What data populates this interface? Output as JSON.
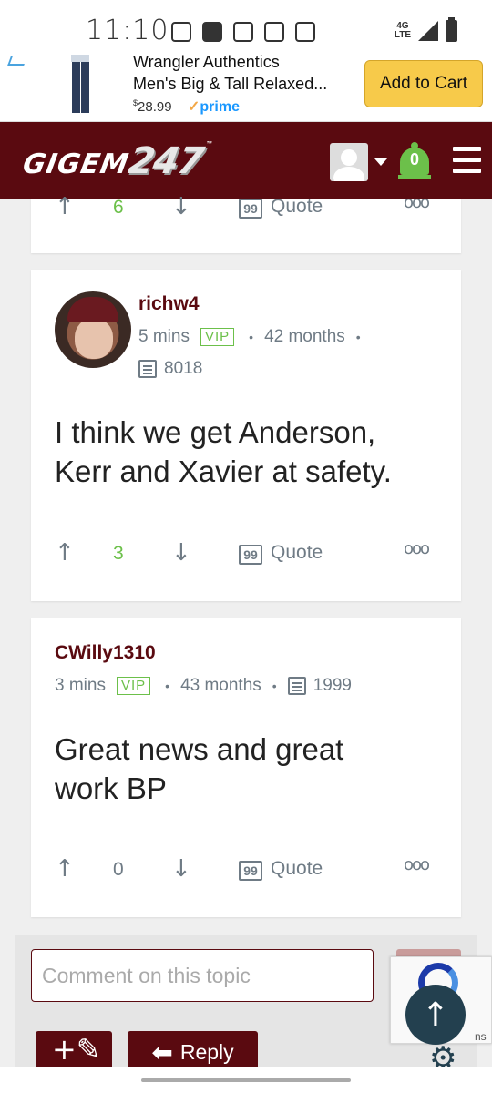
{
  "status_bar": {
    "time": "11:10",
    "network": "4G",
    "network_sub": "LTE",
    "icons": [
      "radio-icon",
      "facebook-icon",
      "gallery-icon",
      "calendar-icon",
      "calendar-icon"
    ]
  },
  "ad": {
    "title_line1": "Wrangler Authentics",
    "title_line2": "Men's Big & Tall Relaxed...",
    "price_symbol": "$",
    "price": "28.99",
    "prime_check": "✓",
    "prime": "prime",
    "cta": "Add to Cart"
  },
  "header": {
    "logo_text": "GIGEM",
    "logo_num": "247",
    "logo_tm": "™",
    "notification_count": "0"
  },
  "posts": [
    {
      "votes": "6",
      "quote_label": "Quote"
    },
    {
      "author": "richw4",
      "time": "5 mins",
      "badge": "VIP",
      "tenure": "42 months",
      "post_count": "8018",
      "body": "I think we get Anderson, Kerr and Xavier at safety.",
      "votes": "3",
      "quote_label": "Quote"
    },
    {
      "author": "CWilly1310",
      "time": "3 mins",
      "badge": "VIP",
      "tenure": "43 months",
      "post_count": "1999",
      "body_line1": "Great news and great",
      "body_line2": "work BP",
      "votes": "0",
      "quote_label": "Quote"
    }
  ],
  "comment": {
    "placeholder": "Comment on this topic"
  },
  "buttons": {
    "reply": "Reply",
    "recaptcha_partial": "ns"
  },
  "colors": {
    "brand": "#5a0a10",
    "accent_green": "#6cc04a",
    "meta_grey": "#6f7b85",
    "fab": "#23404f"
  }
}
